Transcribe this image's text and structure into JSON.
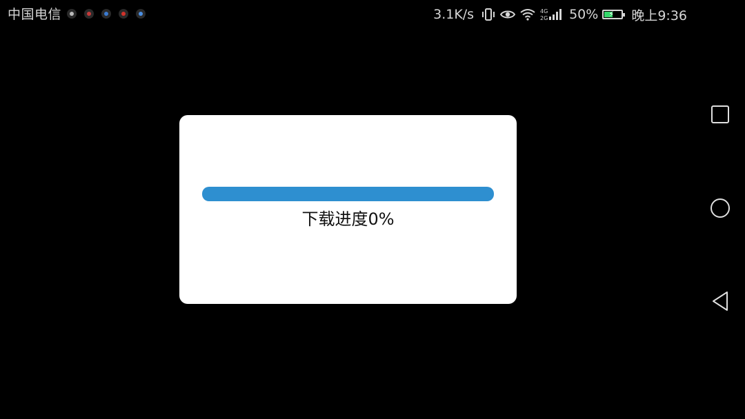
{
  "status_bar": {
    "carrier": "中国电信",
    "notification_icons": [
      "notification-icon-1",
      "notification-icon-2",
      "notification-icon-3",
      "notification-icon-4",
      "notification-icon-5"
    ],
    "network_speed": "3.1K/s",
    "signal_type": "4G 2G",
    "battery_percent": "50%",
    "battery_level": 0.5,
    "time": "晚上9:36"
  },
  "dialog": {
    "progress_label": "下载进度0%",
    "progress_value": 0
  },
  "navigation": {
    "recent_icon": "recent-apps-icon",
    "home_icon": "home-icon",
    "back_icon": "back-icon"
  },
  "colors": {
    "background": "#000000",
    "dialog_background": "#ffffff",
    "progress_bar": "#2e8fd0",
    "battery_fill": "#35d66a"
  }
}
